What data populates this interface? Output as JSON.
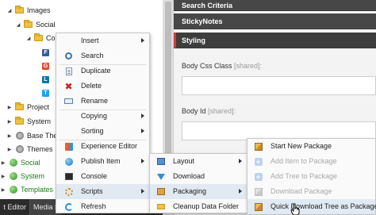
{
  "tree": {
    "nodes": [
      {
        "label": "Images",
        "type": "folder"
      },
      {
        "label": "Social",
        "type": "folder"
      },
      {
        "label": "Con",
        "type": "folder"
      },
      {
        "label": "F",
        "type": "tile",
        "color": "#3b5998"
      },
      {
        "label": "G",
        "type": "tile",
        "color": "#dd4b39"
      },
      {
        "label": "L",
        "type": "tile",
        "color": "#0e76a8"
      },
      {
        "label": "T",
        "type": "tile",
        "color": "#1da1f2"
      },
      {
        "label": "Project",
        "type": "folder"
      },
      {
        "label": "System",
        "type": "folder"
      },
      {
        "label": "Base Ther",
        "type": "item"
      },
      {
        "label": "Themes",
        "type": "item"
      },
      {
        "label": "Social",
        "type": "orb-green"
      },
      {
        "label": "System",
        "type": "orb-green"
      },
      {
        "label": "Templates",
        "type": "orb-green"
      }
    ]
  },
  "editor": {
    "sections": [
      "Search Criteria",
      "StickyNotes",
      "Styling"
    ],
    "fields": [
      {
        "label": "Body Css Class",
        "shared": "[shared]:",
        "value": ""
      },
      {
        "label": "Body Id",
        "shared": "[shared]:",
        "value": ""
      }
    ]
  },
  "tabs": [
    "t Editor",
    "Media L"
  ],
  "menus": {
    "main": [
      {
        "label": "Insert",
        "icon": "none",
        "submenu": true
      },
      {
        "label": "Search",
        "icon": "search-icon",
        "submenu": false
      },
      {
        "label": "Duplicate",
        "icon": "duplicate-icon",
        "submenu": false
      },
      {
        "label": "Delete",
        "icon": "delete-icon",
        "submenu": false
      },
      {
        "label": "Rename",
        "icon": "rename-icon",
        "submenu": false
      },
      {
        "label": "Copying",
        "icon": "none",
        "submenu": true
      },
      {
        "label": "Sorting",
        "icon": "none",
        "submenu": true
      },
      {
        "label": "Experience Editor",
        "icon": "experience-editor-icon",
        "submenu": false
      },
      {
        "label": "Publish Item",
        "icon": "publish-icon",
        "submenu": true
      },
      {
        "label": "Console",
        "icon": "console-icon",
        "submenu": false
      },
      {
        "label": "Scripts",
        "icon": "scripts-icon",
        "submenu": true
      },
      {
        "label": "Refresh",
        "icon": "refresh-icon",
        "submenu": false
      }
    ],
    "scripts_sub": [
      {
        "label": "Layout",
        "icon": "layout-icon",
        "submenu": true
      },
      {
        "label": "Download",
        "icon": "download-icon",
        "submenu": false
      },
      {
        "label": "Packaging",
        "icon": "packaging-icon",
        "submenu": true
      },
      {
        "label": "Cleanup Data Folder",
        "icon": "cleanup-icon",
        "submenu": false
      }
    ],
    "packaging_sub": [
      {
        "label": "Start New Package",
        "icon": "package-icon",
        "disabled": false
      },
      {
        "label": "Add Item to Package",
        "icon": "add-item-icon",
        "disabled": true
      },
      {
        "label": "Add Tree to Package",
        "icon": "add-tree-icon",
        "disabled": true
      },
      {
        "label": "Download Package",
        "icon": "download-package-icon",
        "disabled": true
      },
      {
        "label": "Quick Download Tree as Package",
        "icon": "quick-download-icon",
        "disabled": false
      }
    ]
  },
  "colors": {
    "section_bg": "#474747",
    "accent_red": "#d83a32",
    "menu_highlight": "#e1e9f2",
    "green_text": "#1b7a1b"
  }
}
